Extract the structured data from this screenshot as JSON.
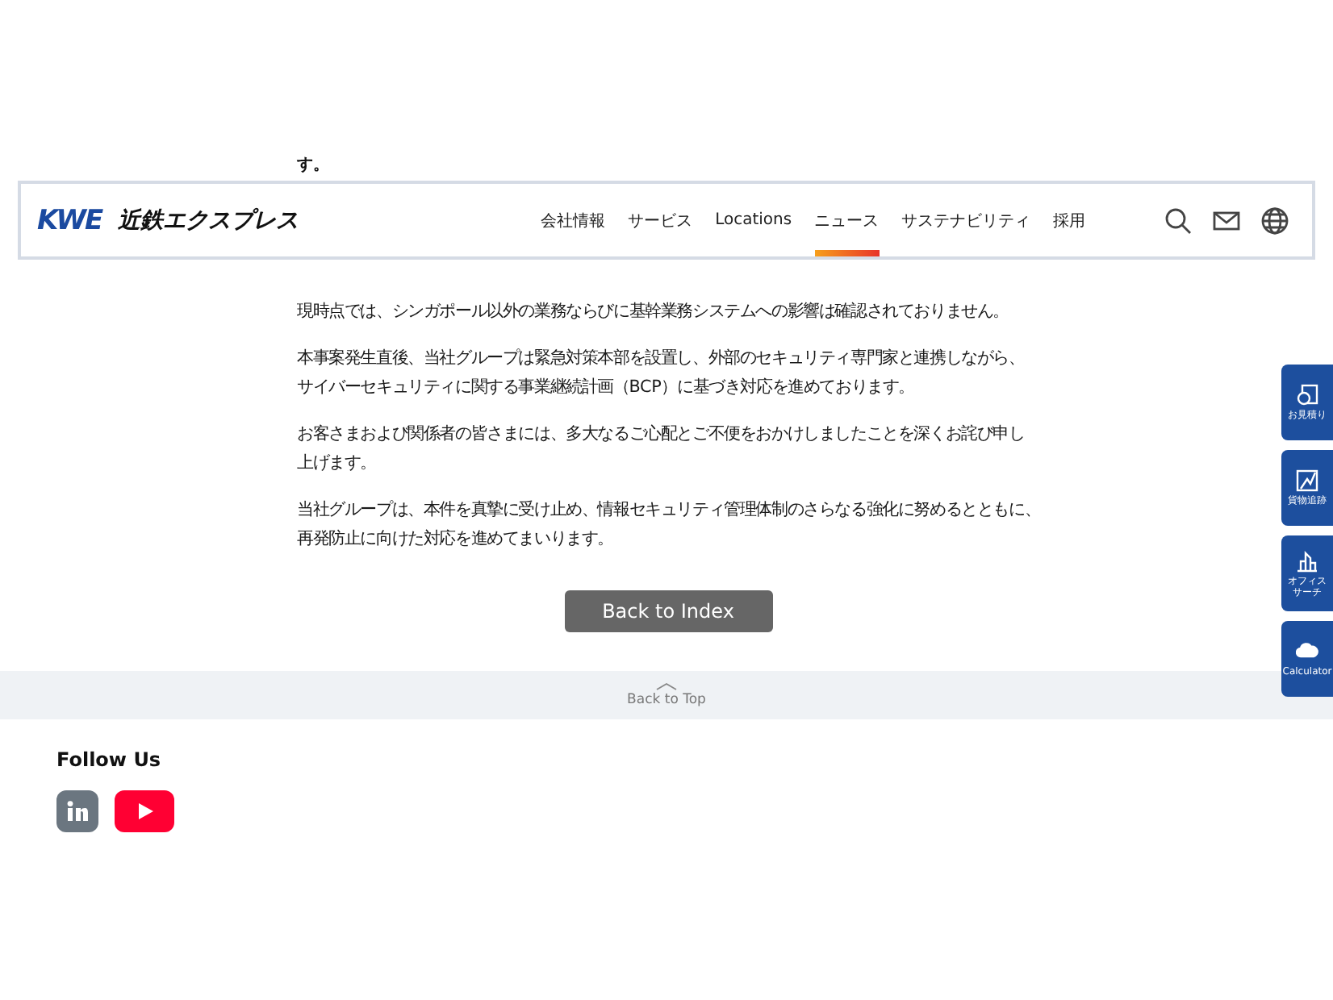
{
  "article": {
    "lead_fragment": "す。",
    "paragraphs": [
      {
        "lines": [
          "現時点では、シンガポール以外の業務ならびに基幹業務システムへの影響は確認されておりません。"
        ]
      },
      {
        "lines": [
          "本事案発生直後、当社グループは緊急対策本部を設置し、外部のセキュリティ専門家と連携しながら、",
          "サイバーセキュリティに関する事業継続計画（BCP）に基づき対応を進めております。"
        ]
      },
      {
        "lines": [
          "お客さまおよび関係者の皆さまには、多大なるご心配とご不便をおかけしましたことを深くお詫び申し",
          "上げます。"
        ]
      },
      {
        "lines": [
          "当社グループは、本件を真摯に受け止め、情報セキュリティ管理体制のさらなる強化に努めるとともに、",
          "再発防止に向けた対応を進めてまいります。"
        ]
      }
    ],
    "back_button": "Back to Index"
  },
  "header": {
    "logo_mark": "KWE",
    "logo_text": "近鉄エクスプレス",
    "nav": [
      {
        "label": "会社情報",
        "selected": false
      },
      {
        "label": "サービス",
        "selected": false
      },
      {
        "label": "Locations",
        "selected": false
      },
      {
        "label": "ニュース",
        "selected": true
      },
      {
        "label": "サステナビリティ",
        "selected": false
      },
      {
        "label": "採用",
        "selected": false
      }
    ],
    "tools": [
      {
        "kind": "search"
      },
      {
        "kind": "mail"
      },
      {
        "kind": "globe"
      }
    ]
  },
  "back_to_top": "Back to Top",
  "footer": {
    "title": "Follow Us",
    "social": [
      {
        "kind": "linkedin"
      },
      {
        "kind": "youtube"
      }
    ]
  },
  "side_buttons": [
    {
      "kind": "quote",
      "lines": [
        "お見積り"
      ]
    },
    {
      "kind": "tracking",
      "lines": [
        "貨物追跡"
      ]
    },
    {
      "kind": "office",
      "lines": [
        "オフィス",
        "サーチ"
      ]
    },
    {
      "kind": "calculator",
      "lines": [
        "Calculator"
      ]
    }
  ]
}
